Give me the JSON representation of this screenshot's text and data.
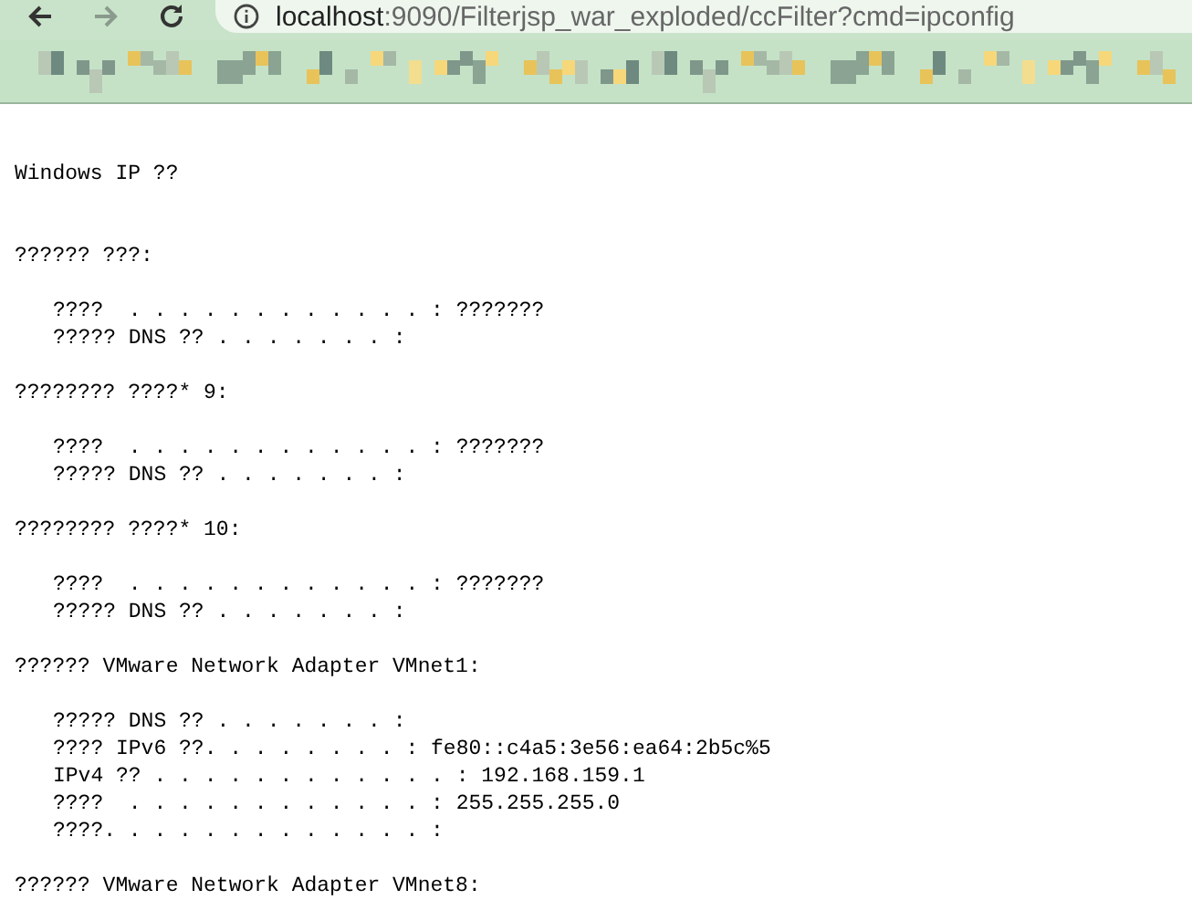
{
  "browser": {
    "url_host": "localhost",
    "url_rest": ":9090/Filterjsp_war_exploded/ccFilter?cmd=ipconfig",
    "forward_disabled": true
  },
  "sections": [
    {
      "heading": "Windows IP ??"
    },
    {
      "heading": "?????? ???:",
      "lines": [
        "????  . . . . . . . . . . . . : ???????",
        "????? DNS ?? . . . . . . . :"
      ]
    },
    {
      "heading": "???????? ????* 9:",
      "lines": [
        "????  . . . . . . . . . . . . : ???????",
        "????? DNS ?? . . . . . . . :"
      ]
    },
    {
      "heading": "???????? ????* 10:",
      "lines": [
        "????  . . . . . . . . . . . . : ???????",
        "????? DNS ?? . . . . . . . :"
      ]
    },
    {
      "heading": "?????? VMware Network Adapter VMnet1:",
      "lines": [
        "????? DNS ?? . . . . . . . :",
        "???? IPv6 ??. . . . . . . . : fe80::c4a5:3e56:ea64:2b5c%5",
        "IPv4 ?? . . . . . . . . . . . . : 192.168.159.1",
        "????  . . . . . . . . . . . . : 255.255.255.0",
        "????. . . . . . . . . . . . . :"
      ]
    },
    {
      "heading": "?????? VMware Network Adapter VMnet8:"
    }
  ]
}
